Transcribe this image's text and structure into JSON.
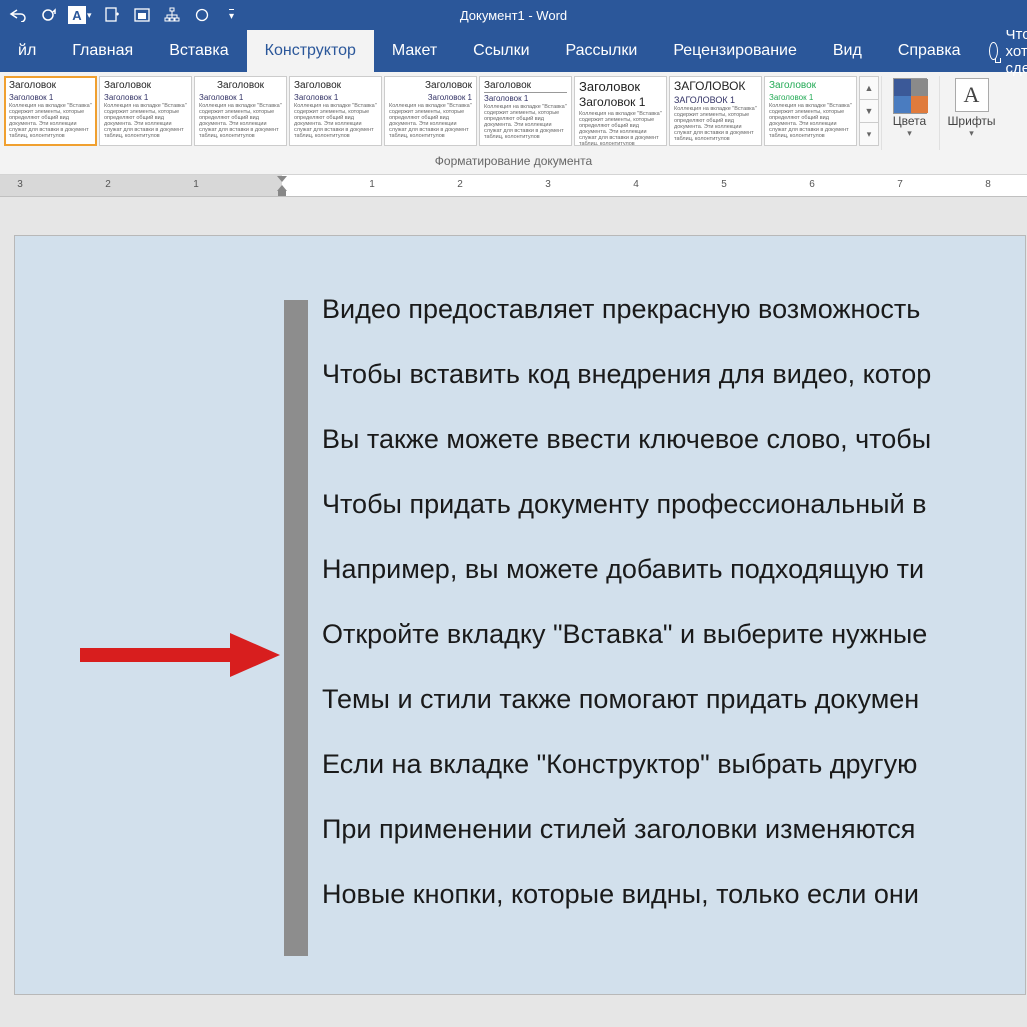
{
  "title": "Документ1  -  Word",
  "tabs": {
    "file": "йл",
    "home": "Главная",
    "insert": "Вставка",
    "design": "Конструктор",
    "layout": "Макет",
    "references": "Ссылки",
    "mailings": "Рассылки",
    "review": "Рецензирование",
    "view": "Вид",
    "help": "Справка"
  },
  "tellme": "Что вы хотите сде",
  "ribbon": {
    "group_label": "Форматирование документа",
    "colors": "Цвета",
    "fonts": "Шрифты",
    "themes": [
      {
        "title": "Заголовок",
        "sub": "Заголовок 1",
        "selected": true
      },
      {
        "title": "Заголовок",
        "sub": "Заголовок 1"
      },
      {
        "title": "Заголовок",
        "sub": "Заголовок 1"
      },
      {
        "title": "Заголовок",
        "sub": "Заголовок 1"
      },
      {
        "title": "Заголовок",
        "sub": "Заголовок 1"
      },
      {
        "title": "Заголовок",
        "sub": "Заголовок 1"
      },
      {
        "title": "Заголовок",
        "sub": "Заголовок 1"
      },
      {
        "title": "ЗАГОЛОВОК",
        "sub": "ЗАГОЛОВОК 1"
      },
      {
        "title": "Заголовок",
        "sub": "Заголовок 1"
      }
    ]
  },
  "ruler": [
    "3",
    "2",
    "1",
    "1",
    "2",
    "3",
    "4",
    "5",
    "6",
    "7",
    "8"
  ],
  "doc": {
    "lines": [
      {
        "b": "-",
        "t": "Видео предоставляет прекрасную возможность"
      },
      {
        "b": "*",
        "t": "Чтобы вставить код внедрения для видео, котор"
      },
      {
        "b": "#",
        "t": "Вы также можете ввести ключевое слово, чтобы"
      },
      {
        "b": "-",
        "t": "Чтобы придать документу профессиональный в"
      },
      {
        "b": "*",
        "t": "Например, вы можете добавить подходящую ти"
      },
      {
        "b": "#",
        "t": "Откройте вкладку \"Вставка\" и выберите нужные"
      },
      {
        "b": "-",
        "t": "Темы и стили также помогают придать докумен"
      },
      {
        "b": "*",
        "t": "Если на вкладке \"Конструктор\" выбрать другую "
      },
      {
        "b": "#",
        "t": "При применении стилей заголовки изменяются "
      },
      {
        "b": "-",
        "t": "Новые кнопки, которые видны, только если они"
      }
    ]
  },
  "theme_filler": "Коллекция на вкладке \"Вставка\" содержит элементы, которые определяют общий вид документа. Эти коллекции служат для вставки в документ таблиц, колонтитулов"
}
